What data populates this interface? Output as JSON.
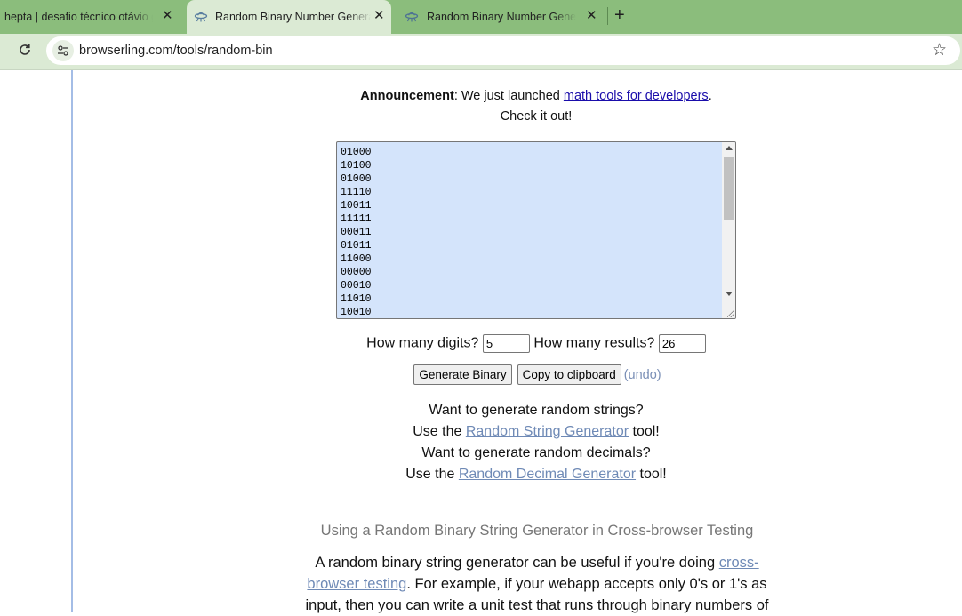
{
  "browser": {
    "tabs": [
      {
        "title": "hepta | desafio técnico otávio g"
      },
      {
        "title": "Random Binary Number Genera"
      },
      {
        "title": "Random Binary Number Genera"
      }
    ],
    "url": "browserling.com/tools/random-bin"
  },
  "announcement": {
    "label": "Announcement",
    "text": ": We just launched ",
    "link": "math tools for developers",
    "end": ".",
    "line2": "Check it out!"
  },
  "output": {
    "lines": [
      "01000",
      "10100",
      "01000",
      "11110",
      "10011",
      "11111",
      "00011",
      "01011",
      "11000",
      "00000",
      "00010",
      "11010",
      "10010"
    ],
    "scroll_position": 0
  },
  "options": {
    "digits_label": "How many digits?",
    "digits_value": "5",
    "results_label": "How many results?",
    "results_value": "26"
  },
  "actions": {
    "generate": "Generate Binary",
    "copy": "Copy to clipboard",
    "undo": "(undo)"
  },
  "promo": {
    "line1": "Want to generate random strings?",
    "line2_pre": "Use the ",
    "line2_link": "Random String Generator",
    "line2_post": " tool!",
    "line3": "Want to generate random decimals?",
    "line4_pre": "Use the ",
    "line4_link": "Random Decimal Generator",
    "line4_post": " tool!"
  },
  "section": {
    "heading": "Using a Random Binary String Generator in Cross-browser Testing",
    "p_pre": "A random binary string generator can be useful if you're doing ",
    "p_link": "cross-browser testing",
    "p_post": ". For example, if your webapp accepts only 0's or 1's as input, then you can write a unit test that runs through binary numbers of"
  }
}
